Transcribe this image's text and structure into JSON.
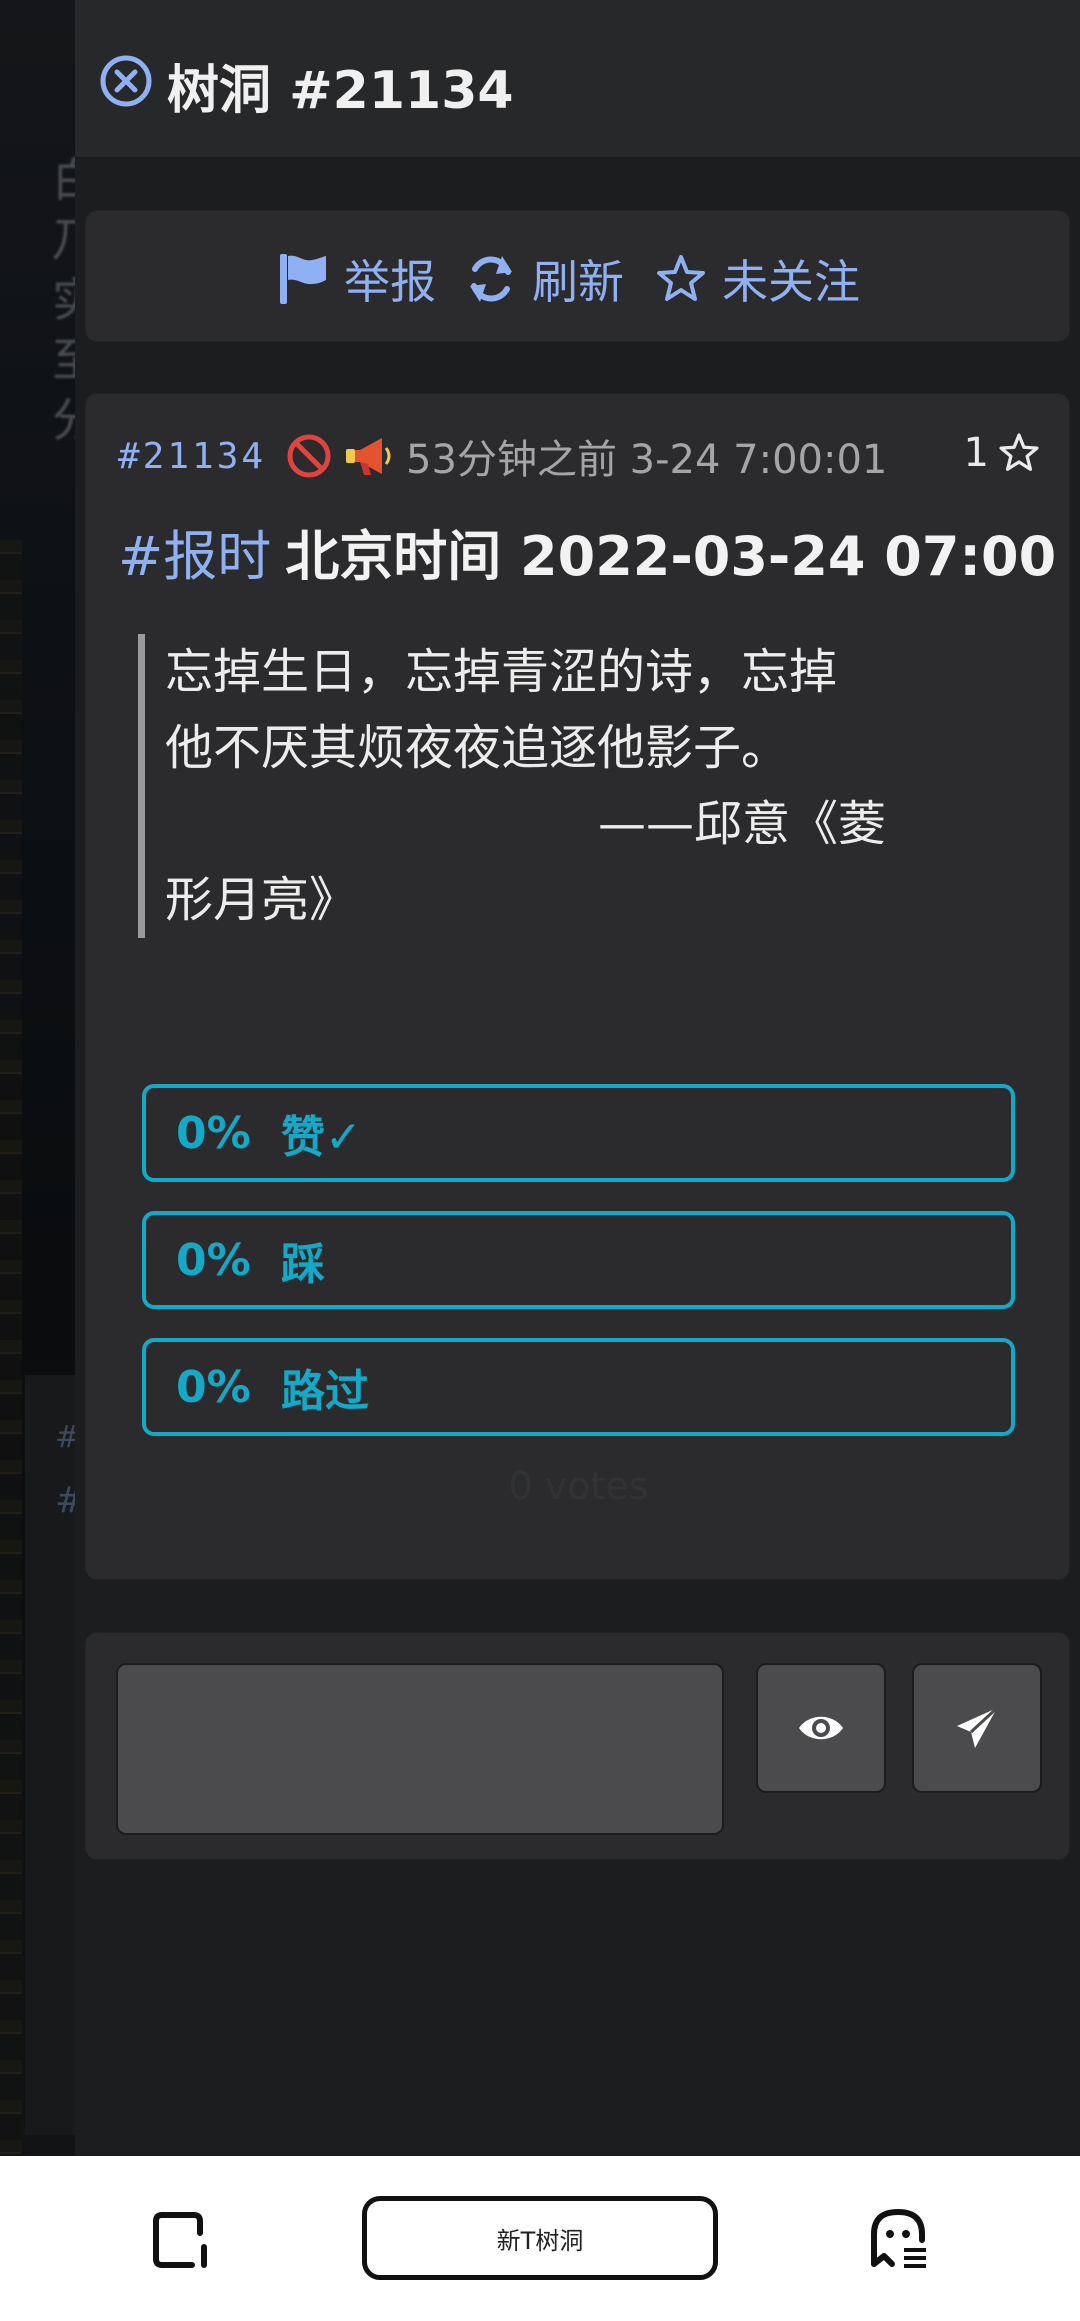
{
  "panel": {
    "title": "树洞 #21134"
  },
  "actions": {
    "report": "举报",
    "refresh": "刷新",
    "follow": "未关注"
  },
  "post": {
    "id": "#21134",
    "time": "53分钟之前 3-24 7:00:01",
    "likes": "1",
    "tag": "#报时",
    "headline": "北京时间 2022-03-24 07:00",
    "quote_lines": [
      "忘掉生日，忘掉青涩的诗，忘掉",
      "他不厌其烦夜夜追逐他影子。"
    ],
    "quote_attr": "——邱意《菱",
    "quote_tail": "形月亮》"
  },
  "poll": {
    "options": [
      {
        "percent": "0%",
        "label": "赞✓"
      },
      {
        "percent": "0%",
        "label": "踩"
      },
      {
        "percent": "0%",
        "label": "路过"
      }
    ],
    "votes": "0 votes"
  },
  "background": {
    "glyphs": [
      "白",
      "乃",
      "实",
      "至",
      "分"
    ],
    "card_hash": "#",
    "card_hash2": "#"
  },
  "bottom_bar": {
    "new_post": "新T树洞"
  },
  "colors": {
    "accent_blue": "#8fb0f3",
    "poll_cyan": "#13a9c9",
    "panel_bg": "#1c1d1f",
    "card_bg": "#2b2b2d"
  },
  "icons": {
    "close": "close-circle-icon",
    "report": "flag-icon",
    "refresh": "refresh-icon",
    "follow": "star-outline-icon",
    "no_reply": "prohibited-icon",
    "announce": "megaphone-icon",
    "like_star": "star-outline-icon",
    "preview": "eye-icon",
    "send": "paper-plane-icon",
    "bottom_left": "tablet-icon",
    "bottom_right": "ghost-face-icon"
  }
}
